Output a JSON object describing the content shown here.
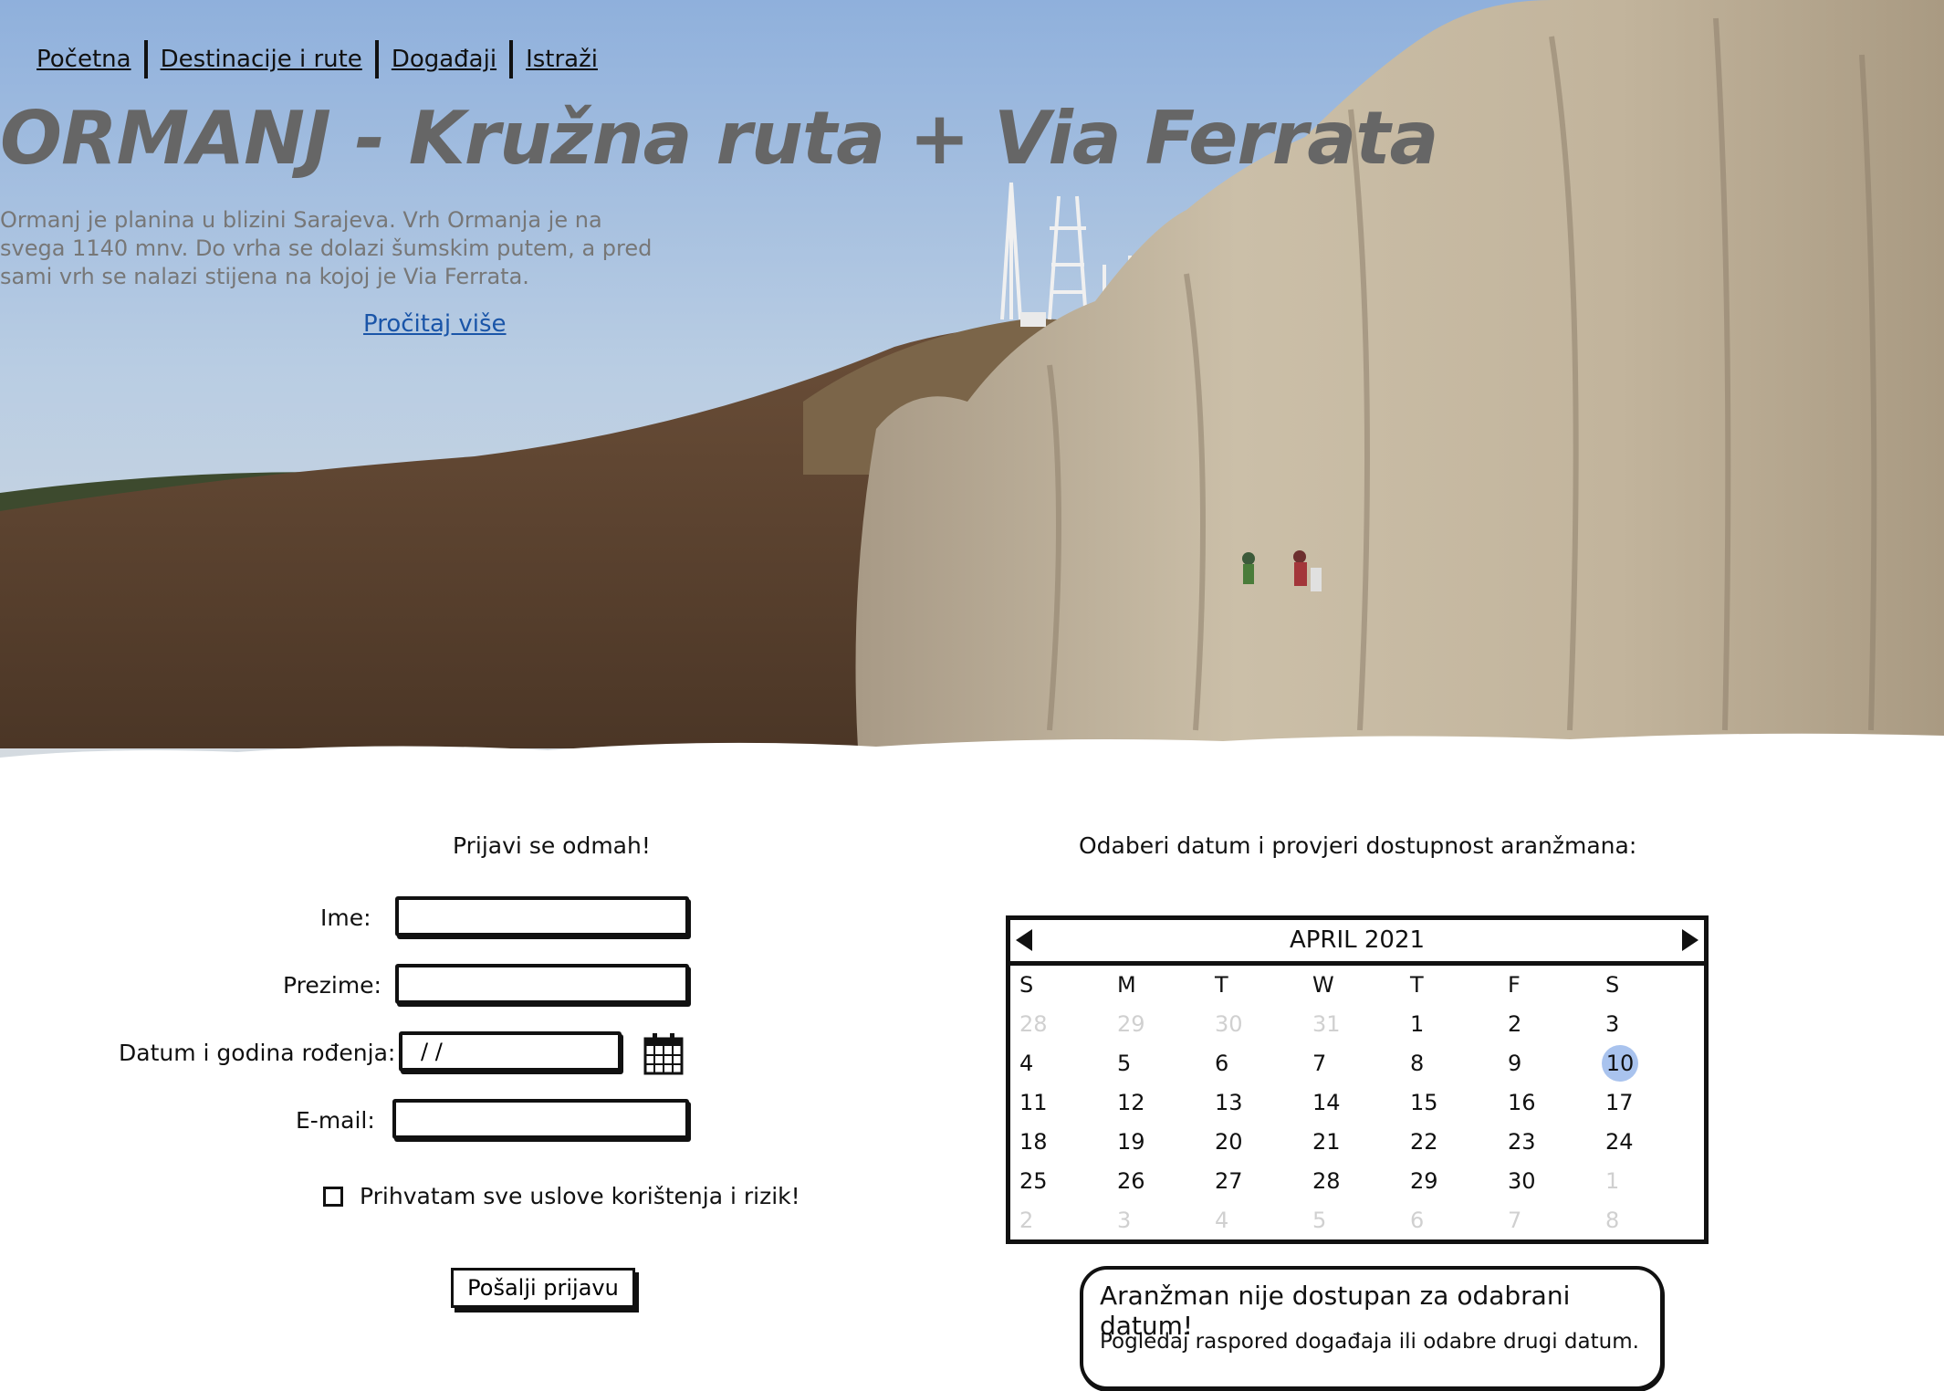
{
  "nav": {
    "items": [
      "Početna",
      "Destinacije i rute",
      "Događaji",
      "Istraži"
    ]
  },
  "hero": {
    "title": "ORMANJ - Kružna ruta + Via Ferrata",
    "description": "Ormanj je planina u blizini Sarajeva. Vrh Ormanja je na svega 1140 mnv. Do vrha se dolazi šumskim putem, a pred sami vrh se nalazi stijena na kojoj je Via Ferrata.",
    "read_more": "Pročitaj više"
  },
  "form": {
    "title": "Prijavi se odmah!",
    "labels": {
      "first_name": "Ime:",
      "last_name": "Prezime:",
      "dob": "Datum i godina rođenja:",
      "email": "E-mail:"
    },
    "values": {
      "first_name": "",
      "last_name": "",
      "dob": "/ /",
      "email": ""
    },
    "terms": "Prihvatam sve uslove korištenja i rizik!",
    "terms_checked": false,
    "submit": "Pošalji prijavu"
  },
  "calendar": {
    "title": "Odaberi datum i provjeri dostupnost aranžmana:",
    "month": "APRIL 2021",
    "weekdays": [
      "S",
      "M",
      "T",
      "W",
      "T",
      "F",
      "S"
    ],
    "days": [
      {
        "d": "28",
        "m": true
      },
      {
        "d": "29",
        "m": true
      },
      {
        "d": "30",
        "m": true
      },
      {
        "d": "31",
        "m": true
      },
      {
        "d": "1"
      },
      {
        "d": "2"
      },
      {
        "d": "3"
      },
      {
        "d": "4"
      },
      {
        "d": "5"
      },
      {
        "d": "6"
      },
      {
        "d": "7"
      },
      {
        "d": "8"
      },
      {
        "d": "9"
      },
      {
        "d": "10",
        "sel": true
      },
      {
        "d": "11"
      },
      {
        "d": "12"
      },
      {
        "d": "13"
      },
      {
        "d": "14"
      },
      {
        "d": "15"
      },
      {
        "d": "16"
      },
      {
        "d": "17"
      },
      {
        "d": "18"
      },
      {
        "d": "19"
      },
      {
        "d": "20"
      },
      {
        "d": "21"
      },
      {
        "d": "22"
      },
      {
        "d": "23"
      },
      {
        "d": "24"
      },
      {
        "d": "25"
      },
      {
        "d": "26"
      },
      {
        "d": "27"
      },
      {
        "d": "28"
      },
      {
        "d": "29"
      },
      {
        "d": "30"
      },
      {
        "d": "1",
        "m": true
      },
      {
        "d": "2",
        "m": true
      },
      {
        "d": "3",
        "m": true
      },
      {
        "d": "4",
        "m": true
      },
      {
        "d": "5",
        "m": true
      },
      {
        "d": "6",
        "m": true
      },
      {
        "d": "7",
        "m": true
      },
      {
        "d": "8",
        "m": true
      }
    ],
    "selected_color": "#a9c3ee"
  },
  "notice": {
    "title": "Aranžman nije dostupan za odabrani datum!",
    "text": "Pogledaj raspored događaja ili odabre drugi datum."
  },
  "colors": {
    "title_grey": "#666666",
    "link_blue": "#1a55a8",
    "sky": "#9cb8dc",
    "rock": "#c8bca6",
    "forest": "#5e4532"
  }
}
